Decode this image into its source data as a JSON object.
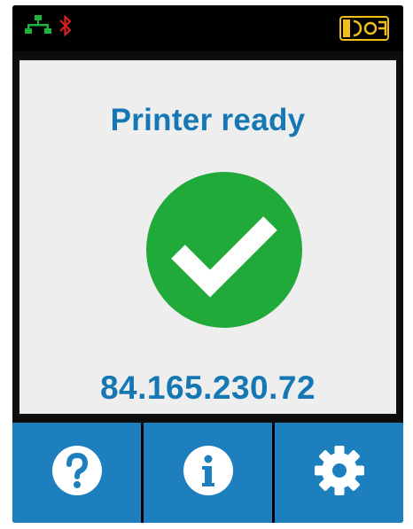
{
  "status_bar": {
    "network_icon": "network-icon",
    "bluetooth_icon": "bluetooth-icon",
    "battery_icon": "battery-icon",
    "network_color": "#1db33c",
    "bluetooth_color": "#d42020",
    "battery_color": "#f2c018"
  },
  "main": {
    "status_title": "Printer ready",
    "status_icon": "checkmark-circle-icon",
    "status_color": "#1faa3a",
    "ip_address": "84.165.230.72"
  },
  "toolbar": {
    "buttons": [
      {
        "icon": "help-icon"
      },
      {
        "icon": "info-icon"
      },
      {
        "icon": "settings-gear-icon"
      }
    ],
    "accent_color": "#1e7fbf"
  }
}
